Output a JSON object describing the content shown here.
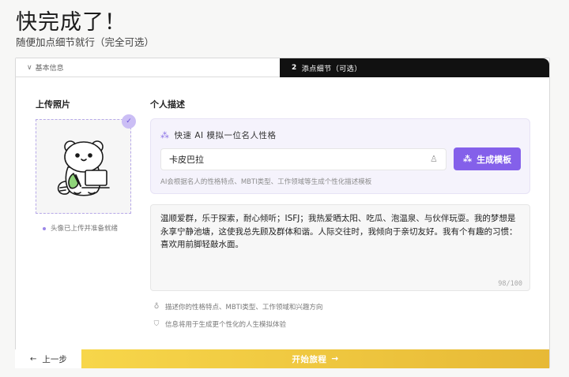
{
  "header": {
    "title": "快完成了！",
    "subtitle": "随便加点细节就行（完全可选）"
  },
  "tabs": {
    "basic_label": "基本信息",
    "active_number": "2",
    "active_label": "添点细节（可选）"
  },
  "photo": {
    "heading": "上传照片",
    "status": "头像已上传并准备就绪"
  },
  "description": {
    "heading": "个人描述",
    "ai": {
      "title": "快速 AI 模拟一位名人性格",
      "input_value": "卡皮巴拉",
      "generate_label": "生成模板",
      "hint": "AI会根据名人的性格特点、MBTI类型、工作领域等生成个性化描述模板"
    },
    "text": "温顺爱群，乐于探索，耐心倾听；ISFJ；我热爱晒太阳、吃瓜、泡温泉、与伙伴玩耍。我的梦想是永享宁静池塘，这使我总先顾及群体和谐。人际交往时，我倾向于亲切友好。我有个有趣的习惯：喜欢用前脚轻敲水面。",
    "counter": "98/100",
    "tips": [
      "描述你的性格特点、MBTI类型、工作领域和兴趣方向",
      "信息将用于生成更个性化的人生模拟体验"
    ]
  },
  "footer": {
    "prev_label": "上一步",
    "start_label": "开始旅程"
  },
  "colors": {
    "accent": "#8460ea",
    "start_gradient": [
      "#f7d64a",
      "#e7b936"
    ],
    "tab_active": "#111111"
  }
}
